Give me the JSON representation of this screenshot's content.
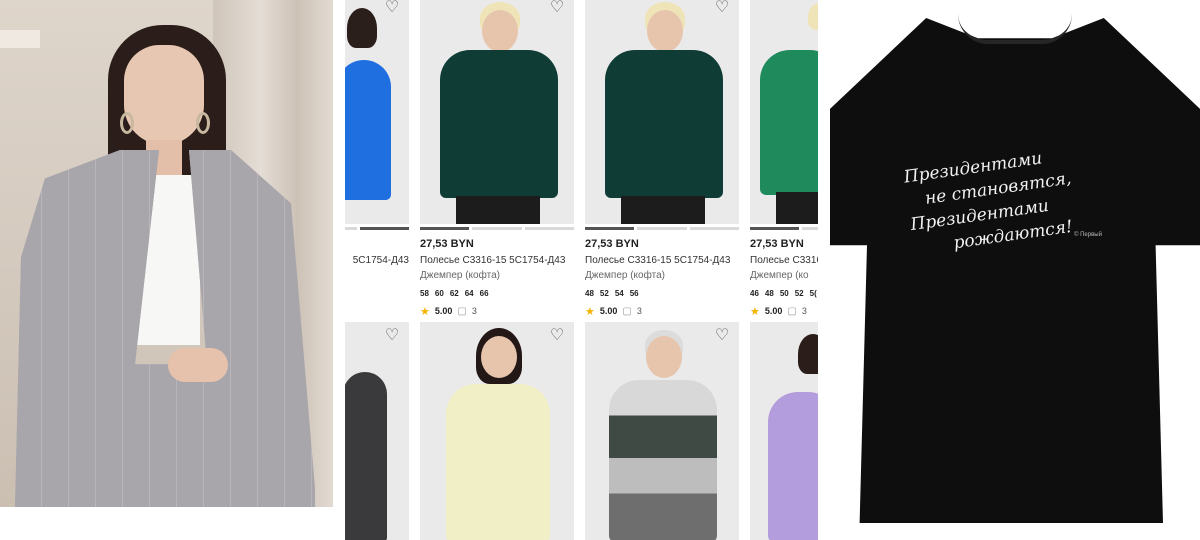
{
  "promo": {
    "alt": ""
  },
  "products": [
    {
      "price": "",
      "title": "5С1754-Д43",
      "category": "",
      "sizes": [],
      "rating": "",
      "reviews": ""
    },
    {
      "price": "27,53 BYN",
      "title": "Полесье С3316-15 5С1754-Д43",
      "category": "Джемпер (кофта)",
      "sizes": [
        "58",
        "60",
        "62",
        "64",
        "66"
      ],
      "rating": "5.00",
      "reviews": "3"
    },
    {
      "price": "27,53 BYN",
      "title": "Полесье С3316-15 5С1754-Д43",
      "category": "Джемпер (кофта)",
      "sizes": [
        "48",
        "52",
        "54",
        "56"
      ],
      "rating": "5.00",
      "reviews": "3"
    },
    {
      "price": "27,53 BYN",
      "title": "Полесье С3316",
      "category": "Джемпер (ко",
      "sizes": [
        "46",
        "48",
        "50",
        "52",
        "5("
      ],
      "rating": "5.00",
      "reviews": "3"
    }
  ],
  "tshirt": {
    "slogan_lines": [
      "Президентами",
      "не становятся,",
      "Президентами",
      "рождаются!"
    ],
    "brand": "© Первый"
  },
  "icons": {
    "favorite": "heart-outline-icon",
    "rating": "star-icon",
    "reviews": "comment-icon"
  },
  "colors": {
    "star": "#f5b301",
    "tshirt": "#0e0e0e",
    "active_indicator": "#555555"
  }
}
